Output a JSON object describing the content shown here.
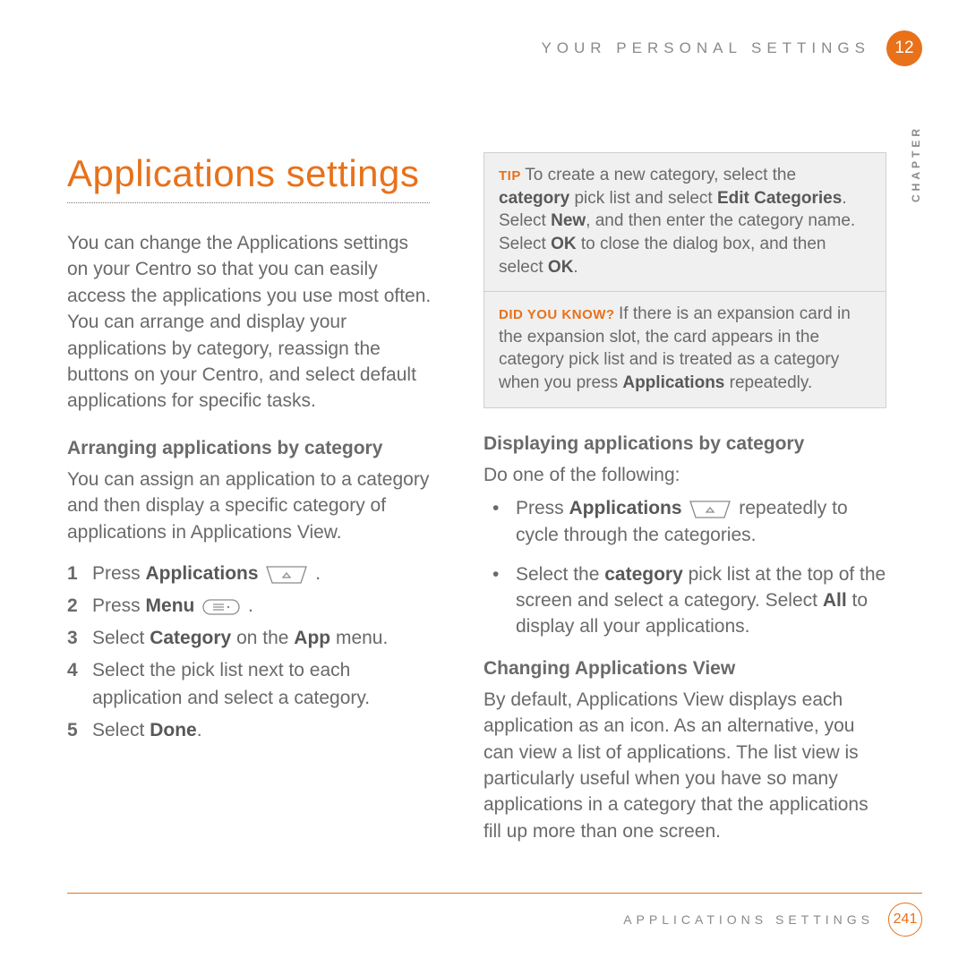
{
  "header": {
    "section": "YOUR PERSONAL SETTINGS",
    "chapterNumber": "12",
    "chapterWord": "CHAPTER"
  },
  "left": {
    "title": "Applications settings",
    "intro": "You can change the Applications settings on your Centro so that you can easily access the applications you use most often. You can arrange and display your applications by category, reassign the buttons on your Centro, and select default applications for specific tasks.",
    "sub1": "Arranging applications by category",
    "sub1para": "You can assign an application to a category and then display a specific category of applications in Applications View.",
    "steps": {
      "s1_a": "Press ",
      "s1_b": "Applications",
      "s1_c": " .",
      "s2_a": "Press ",
      "s2_b": "Menu",
      "s2_c": " .",
      "s3_a": "Select ",
      "s3_b": "Category",
      "s3_c": " on the ",
      "s3_d": "App",
      "s3_e": " menu.",
      "s4": "Select the pick list next to each application and select a category.",
      "s5_a": "Select ",
      "s5_b": "Done",
      "s5_c": "."
    }
  },
  "right": {
    "tipLabel": "TIP",
    "tip_a": "To create a new category, select the ",
    "tip_b": "category",
    "tip_c": " pick list and select ",
    "tip_d": "Edit Categories",
    "tip_e": ". Select ",
    "tip_f": "New",
    "tip_g": ", and then enter the category name. Select ",
    "tip_h": "OK",
    "tip_i": " to close the dialog box, and then select ",
    "tip_j": "OK",
    "tip_k": ".",
    "dykLabel": "DID YOU KNOW?",
    "dyk_a": "If there is an expansion card in the expansion slot, the card appears in the category pick list and is treated as a category when you press ",
    "dyk_b": "Applications",
    "dyk_c": " repeatedly.",
    "sub2": "Displaying applications by category",
    "sub2para": "Do one of the following:",
    "b1_a": "Press ",
    "b1_b": "Applications",
    "b1_c": " repeatedly to cycle through the categories.",
    "b2_a": "Select the ",
    "b2_b": "category",
    "b2_c": " pick list at the top of the screen and select a category. Select ",
    "b2_d": "All",
    "b2_e": " to display all your applications.",
    "sub3": "Changing Applications View",
    "sub3para": "By default, Applications View displays each application as an icon. As an alternative, you can view a list of applications. The list view is particularly useful when you have so many applications in a category that the applications fill up more than one screen."
  },
  "footer": {
    "label": "APPLICATIONS SETTINGS",
    "page": "241"
  }
}
